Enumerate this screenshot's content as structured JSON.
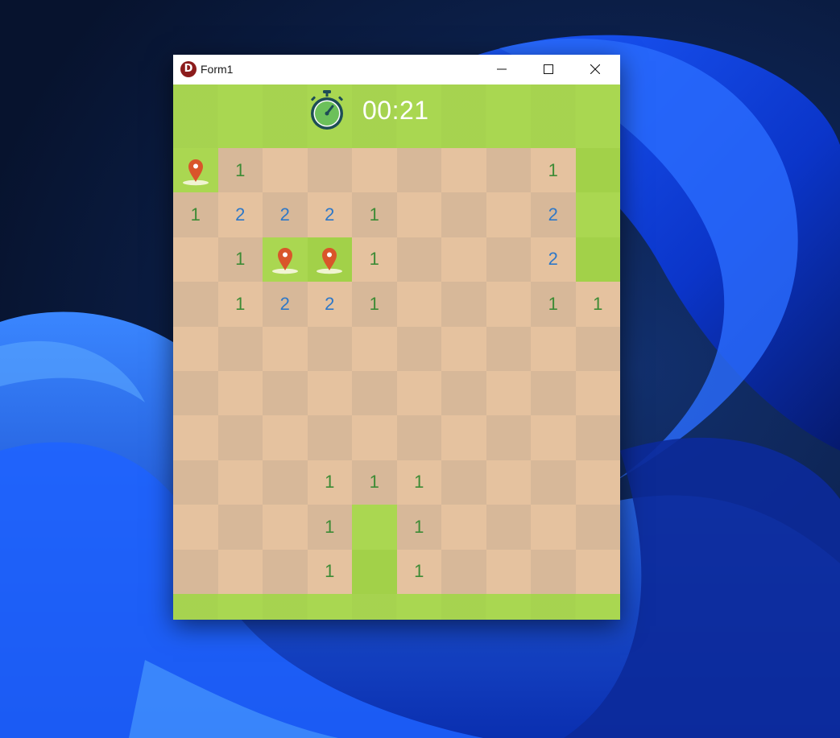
{
  "window": {
    "title": "Form1",
    "app_icon_letter": "D"
  },
  "header": {
    "timer": "00:21",
    "timer_icon": "stopwatch-icon"
  },
  "colors": {
    "grass_light": "#aad751",
    "grass_dark": "#a2d149",
    "dirt_light": "#e5c29f",
    "dirt_dark": "#d7b899",
    "number_1": "#3d8b35",
    "number_2": "#2e78c8",
    "flag": "#d9552a"
  },
  "board": {
    "rows": 10,
    "cols": 10,
    "cells": [
      [
        "F",
        "1",
        "",
        "",
        "",
        "",
        "",
        "",
        "1",
        "G"
      ],
      [
        "1",
        "2",
        "2",
        "2",
        "1",
        "",
        "",
        "",
        "2",
        "G"
      ],
      [
        "",
        "1",
        "F",
        "F",
        "1",
        "",
        "",
        "",
        "2",
        "G"
      ],
      [
        "",
        "1",
        "2",
        "2",
        "1",
        "",
        "",
        "",
        "1",
        "1"
      ],
      [
        "",
        "",
        "",
        "",
        "",
        "",
        "",
        "",
        "",
        ""
      ],
      [
        "",
        "",
        "",
        "",
        "",
        "",
        "",
        "",
        "",
        ""
      ],
      [
        "",
        "",
        "",
        "",
        "",
        "",
        "",
        "",
        "",
        ""
      ],
      [
        "",
        "",
        "",
        "1",
        "1",
        "1",
        "",
        "",
        "",
        ""
      ],
      [
        "",
        "",
        "",
        "1",
        "G",
        "1",
        "",
        "",
        "",
        ""
      ],
      [
        "",
        "",
        "",
        "1",
        "G",
        "1",
        "",
        "",
        "",
        ""
      ]
    ]
  }
}
